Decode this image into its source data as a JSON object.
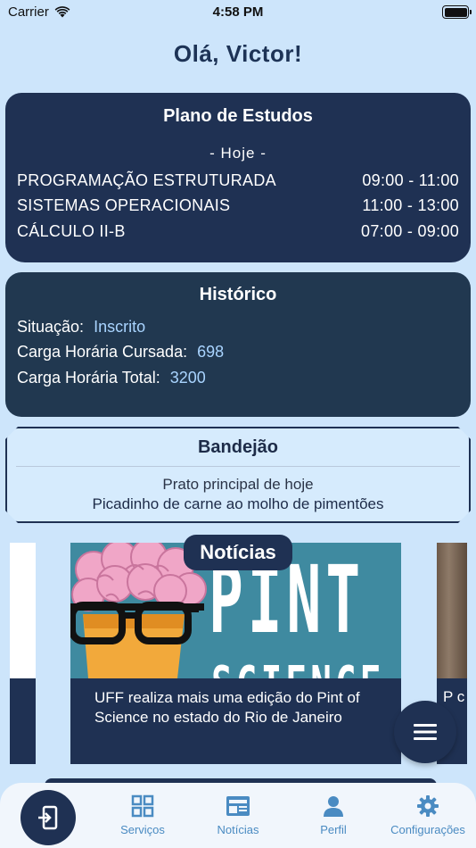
{
  "status_bar": {
    "carrier": "Carrier",
    "time": "4:58 PM"
  },
  "greeting": "Olá, Victor!",
  "plano": {
    "title": "Plano de Estudos",
    "today_label": "- Hoje -",
    "classes": [
      {
        "name": "PROGRAMAÇÃO ESTRUTURADA",
        "time": "09:00 - 11:00"
      },
      {
        "name": "SISTEMAS OPERACIONAIS",
        "time": "11:00 - 13:00"
      },
      {
        "name": "CÁLCULO II-B",
        "time": "07:00 - 09:00"
      }
    ]
  },
  "historico": {
    "title": "Histórico",
    "situacao_label": "Situação:",
    "situacao_value": "Inscrito",
    "cursada_label": "Carga Horária Cursada:",
    "cursada_value": "698",
    "total_label": "Carga Horária Total:",
    "total_value": "3200"
  },
  "bandejao": {
    "title": "Bandejão",
    "label": "Prato principal de hoje",
    "meal": "Picadinho de carne ao molho de pimentões"
  },
  "noticias": {
    "title": "Notícias",
    "items": [
      {
        "caption": "UFF realiza mais uma edição do Pint of Science no estado do Rio de Janeiro",
        "image_text": "PINT OF",
        "image_text2": "SCIENCE"
      }
    ],
    "next_caption": "P c a"
  },
  "menu_fab": {
    "icon": "menu-icon"
  },
  "bottom_nav": {
    "items": [
      {
        "label": "Serviços",
        "icon": "grid-icon"
      },
      {
        "label": "Notícias",
        "icon": "newspaper-icon"
      },
      {
        "label": "Perfil",
        "icon": "person-icon"
      },
      {
        "label": "Configurações",
        "icon": "gear-icon"
      }
    ]
  },
  "colors": {
    "background": "#cde5fb",
    "navy": "#1f3153",
    "accent": "#4a8bc2",
    "value_blue": "#a9d4ff"
  }
}
